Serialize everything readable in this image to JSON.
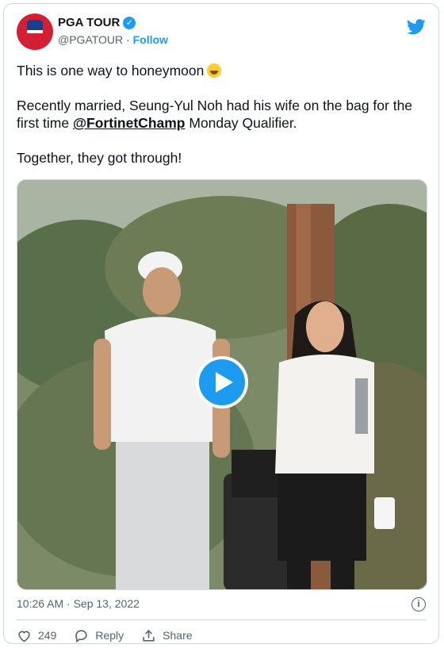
{
  "author": {
    "display_name": "PGA TOUR",
    "handle": "@PGATOUR",
    "separator": "·",
    "follow_label": "Follow"
  },
  "tweet": {
    "line1": "This is one way to honeymoon",
    "line2_before": "Recently married, Seung-Yul Noh had his wife on the bag for the first time ",
    "mention": "@FortinetChamp",
    "line2_after": " Monday Qualifier.",
    "line3": "Together, they got through!"
  },
  "meta": {
    "timestamp": "10:26 AM · Sep 13, 2022",
    "info_symbol": "i"
  },
  "actions": {
    "like_count": "249",
    "reply_label": "Reply",
    "share_label": "Share"
  },
  "colors": {
    "accent": "#1d9bf0",
    "brand_red": "#d21f33",
    "brand_blue": "#1a3e8c"
  },
  "icons": [
    "verified-badge-icon",
    "twitter-bird-icon",
    "rofl-emoji-icon",
    "play-icon",
    "info-icon",
    "heart-icon",
    "reply-icon",
    "share-icon"
  ]
}
